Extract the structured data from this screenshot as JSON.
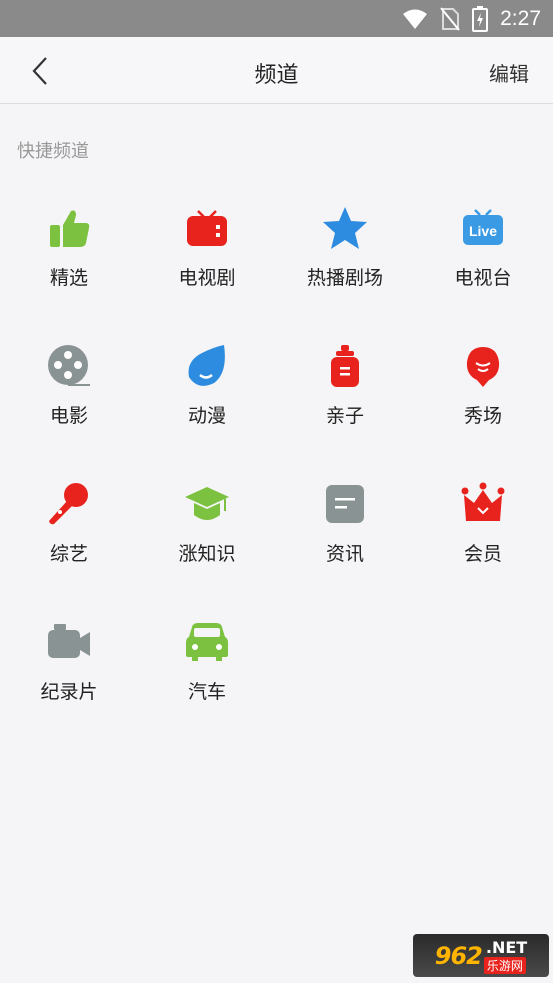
{
  "status_bar": {
    "time": "2:27"
  },
  "header": {
    "title": "频道",
    "edit_label": "编辑"
  },
  "section": {
    "title": "快捷频道"
  },
  "channels": [
    {
      "label": "精选",
      "icon": "thumbs-up-icon",
      "color": "#7cc240"
    },
    {
      "label": "电视剧",
      "icon": "tv-icon",
      "color": "#e8231d"
    },
    {
      "label": "热播剧场",
      "icon": "star-icon",
      "color": "#2d8be0"
    },
    {
      "label": "电视台",
      "icon": "live-tv-icon",
      "color": "#3a9ae4"
    },
    {
      "label": "电影",
      "icon": "film-reel-icon",
      "color": "#8a9393"
    },
    {
      "label": "动漫",
      "icon": "anime-drop-icon",
      "color": "#2d8be0"
    },
    {
      "label": "亲子",
      "icon": "baby-bottle-icon",
      "color": "#e8231d"
    },
    {
      "label": "秀场",
      "icon": "balloon-icon",
      "color": "#e8231d"
    },
    {
      "label": "综艺",
      "icon": "microphone-icon",
      "color": "#e8231d"
    },
    {
      "label": "涨知识",
      "icon": "graduation-cap-icon",
      "color": "#7cc240"
    },
    {
      "label": "资讯",
      "icon": "news-icon",
      "color": "#8a9393"
    },
    {
      "label": "会员",
      "icon": "crown-icon",
      "color": "#e8231d"
    },
    {
      "label": "纪录片",
      "icon": "camera-icon",
      "color": "#8a9393"
    },
    {
      "label": "汽车",
      "icon": "car-icon",
      "color": "#7cc240"
    }
  ],
  "watermark": {
    "number": "962",
    "domain": ".NET",
    "subtitle": "乐游网"
  }
}
